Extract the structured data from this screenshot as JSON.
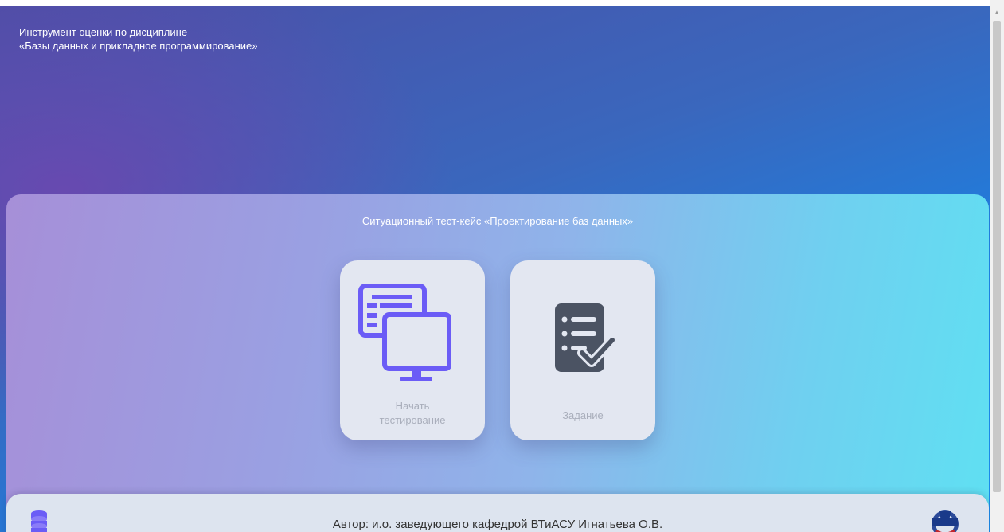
{
  "header": {
    "line1": "Инструмент оценки по дисциплине",
    "line2": "«Базы данных и прикладное программирование»"
  },
  "panel": {
    "title": "Ситуационный тест-кейс «Проектирование баз данных»"
  },
  "cards": [
    {
      "label_line1": "Начать",
      "label_line2": "тестирование",
      "icon": "monitors-icon"
    },
    {
      "label": "Задание",
      "icon": "checklist-icon"
    }
  ],
  "footer": {
    "author": "Автор: и.о. заведующего кафедрой ВТиАСУ Игнатьева О.В.",
    "left_icon": "database-icon",
    "right_icon": "university-logo"
  },
  "colors": {
    "accent_icon": "#6b5cf6",
    "dark_icon": "#4b5363",
    "card_bg": "#e3e7f1",
    "card_text": "#a9aebb"
  }
}
